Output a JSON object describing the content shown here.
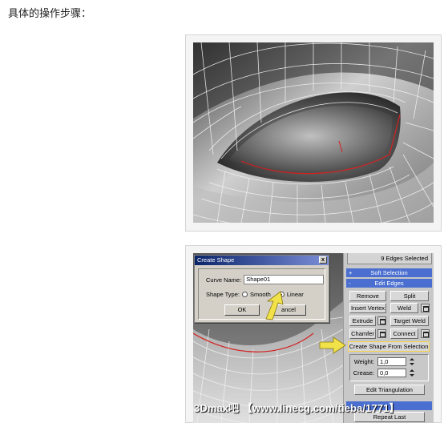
{
  "page": {
    "heading": "具体的操作步骤："
  },
  "dialog": {
    "title": "Create Shape",
    "close_label": "x",
    "curve_name_label": "Curve Name:",
    "curve_name_value": "Shape01",
    "shape_type_label": "Shape Type:",
    "options": [
      "Smooth",
      "Linear"
    ],
    "selected_option": "Linear",
    "ok_label": "OK",
    "cancel_label": "ancel"
  },
  "panel": {
    "selection_status": "9 Edges Selected",
    "soft_selection": {
      "sign": "+",
      "label": "Soft Selection"
    },
    "edit_edges": {
      "sign": "-",
      "label": "Edit Edges"
    },
    "buttons": {
      "remove": "Remove",
      "split": "Split",
      "insert_vertex": "Insert Vertex",
      "weld": "Weld",
      "extrude": "Extrude",
      "target_weld": "Target Weld",
      "chamfer": "Chamfer",
      "connect": "Connect",
      "create_shape": "Create Shape From Selection",
      "edit_triangulation": "Edit Triangulation",
      "repeat_last": "Repeat Last"
    },
    "weight": {
      "label": "Weight:",
      "value": "1,0"
    },
    "crease": {
      "label": "Crease:",
      "value": "0,0"
    }
  },
  "watermark": "3Dmax吧 【www.linecg.com/tieba/1771】",
  "colors": {
    "rollout": "#4a6fd0",
    "arrow": "#f2e24a",
    "edge_selection": "#d42020",
    "titlebar": "#0a246a"
  },
  "icons": {
    "dialog_close": "close-icon",
    "radio": "radio-icon",
    "settings": "settings-box-icon",
    "spinner": "spinner-icon",
    "arrow": "pointer-arrow-icon"
  }
}
